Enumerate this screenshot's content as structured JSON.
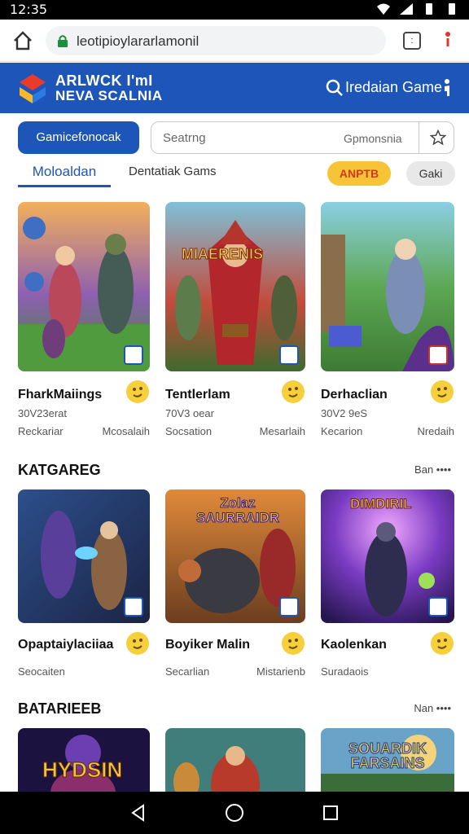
{
  "status_bar": {
    "time": "12:35"
  },
  "browser": {
    "url": "leotipioylararlamonil",
    "tabs_count": ":"
  },
  "banner": {
    "brand_line1": "ARLWCK I'mI",
    "brand_line2": "NEVA SCALNIA",
    "search_label": "Iredaian Game"
  },
  "filters": {
    "primary_button": "Gamicefonocak",
    "search_placeholder": "Seatrng",
    "search_category": "Gpmonsnia"
  },
  "tabs": [
    {
      "label": "Moloaldan"
    },
    {
      "label": "Dentatiak Gams"
    }
  ],
  "chips": [
    {
      "label": "ANPTB"
    },
    {
      "label": "Gaki"
    }
  ],
  "row1": [
    {
      "title": "FharkMaiings",
      "subtitle": "30V23erat",
      "meta_left": "Reckariar",
      "meta_right": "Mcosalaih"
    },
    {
      "title": "Tentlerlam",
      "subtitle": "70V3 oear",
      "meta_left": "Socsation",
      "meta_right": "Mesarlaih"
    },
    {
      "title": "Derhaclian",
      "subtitle": "30V2 9eS",
      "meta_left": "Kecarion",
      "meta_right": "Nredaih"
    }
  ],
  "section2": {
    "title": "KATGAREG",
    "more": "Ban ••••"
  },
  "row2": [
    {
      "title": "Opaptaiylaciiaa",
      "meta_left": "Seocaiten",
      "meta_right": ""
    },
    {
      "title": "Boyiker Malin",
      "meta_left": "Secarlian",
      "meta_right": "Mistarienb"
    },
    {
      "title": "Kaolenkan",
      "meta_left": "Suradaois",
      "meta_right": ""
    }
  ],
  "section3": {
    "title": "BATARIEEB",
    "more": "Nan ••••"
  },
  "row3": [
    {
      "title": "HYDSIN"
    },
    {
      "title": ""
    },
    {
      "title": "SOUARDIK FARSAINS"
    }
  ],
  "row2_art_titles": [
    "",
    "Zolaz SAURRAIDR",
    "DIMDIRIL"
  ],
  "row1_art_titles": [
    "",
    "MIAERENIS",
    ""
  ],
  "colors": {
    "brand_blue": "#1d56b8",
    "chip_orange": "#f7c437",
    "chip_orange_text": "#d13b1b"
  }
}
